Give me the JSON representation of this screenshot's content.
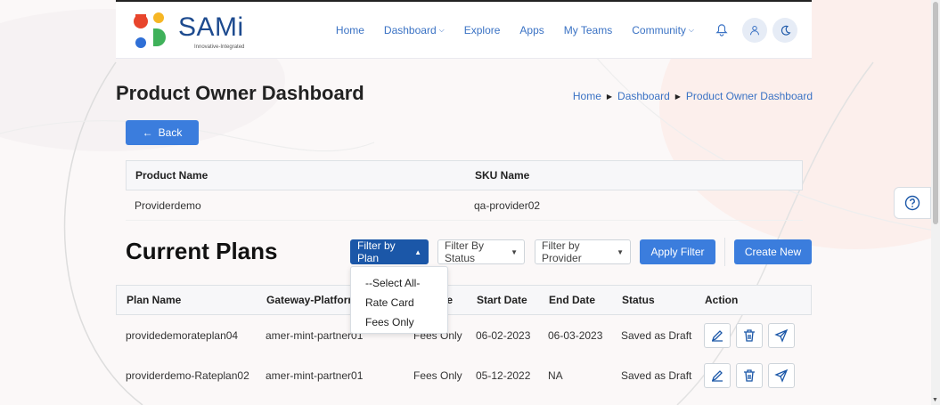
{
  "app": {
    "brand": "SAMi",
    "tagline": "Innovative-Integrated"
  },
  "nav": {
    "items": [
      "Home",
      "Dashboard",
      "Explore",
      "Apps",
      "My Teams",
      "Community"
    ],
    "icons": [
      "bell-icon",
      "user-icon",
      "moon-icon"
    ]
  },
  "page": {
    "title": "Product Owner Dashboard",
    "breadcrumb": [
      "Home",
      "Dashboard",
      "Product Owner Dashboard"
    ],
    "back_label": "Back"
  },
  "product": {
    "headers": [
      "Product Name",
      "SKU Name"
    ],
    "row": [
      "Providerdemo",
      "qa-provider02"
    ]
  },
  "plans": {
    "section_title": "Current Plans",
    "filters": {
      "plan": "Filter by Plan",
      "status": "Filter By Status",
      "provider": "Filter by Provider",
      "apply": "Apply Filter",
      "create": "Create New"
    },
    "plan_options": [
      "--Select All-",
      "Rate Card",
      "Fees Only"
    ],
    "headers": [
      "Plan Name",
      "Gateway-Platform I",
      "pe",
      "Start Date",
      "End Date",
      "Status",
      "Action"
    ],
    "rows": [
      [
        "providedemorateplan04",
        "amer-mint-partner01",
        "Fees Only",
        "06-02-2023",
        "06-03-2023",
        "Saved as Draft"
      ],
      [
        "providerdemo-Rateplan02",
        "amer-mint-partner01",
        "Fees Only",
        "05-12-2022",
        "NA",
        "Saved as Draft"
      ]
    ]
  },
  "colors": {
    "primary": "#3b7ddd",
    "dark_primary": "#1b57a8",
    "link": "#3a72c4"
  }
}
